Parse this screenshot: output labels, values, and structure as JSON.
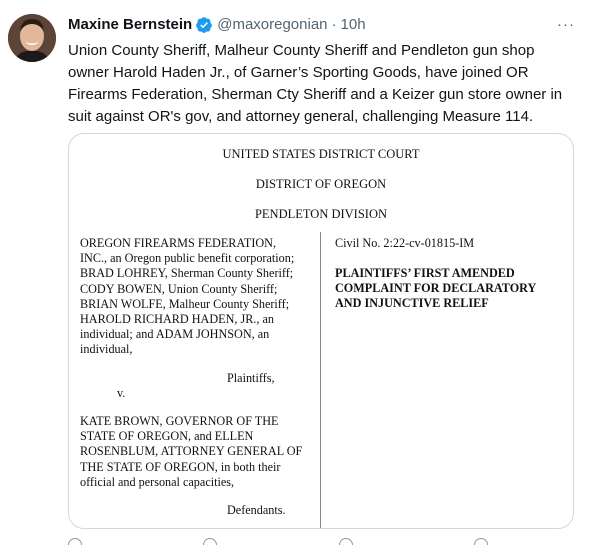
{
  "tweet": {
    "author": {
      "display_name": "Maxine Bernstein",
      "handle": "@maxoregonian",
      "verified_icon": "verified-badge-icon",
      "avatar": "author-photo"
    },
    "separator": "·",
    "timestamp": "10h",
    "more_icon": "more-options-icon",
    "more_label": "···",
    "text_lines": [
      "Union County Sheriff, Malheur County Sheriff and Pendleton gun shop",
      "owner Harold Haden Jr., of Garner’s Sporting Goods, have joined OR",
      "Firearms Federation, Sherman Cty Sheriff and a Keizer gun store owner in",
      "suit against OR's gov, and attorney general, challenging Measure 114."
    ]
  },
  "document": {
    "court": "UNITED STATES DISTRICT COURT",
    "district": "DISTRICT OF OREGON",
    "division": "PENDLETON DIVISION",
    "plaintiffs_lines": [
      "OREGON FIREARMS FEDERATION,",
      "INC., an Oregon public benefit corporation;",
      "BRAD LOHREY, Sherman County Sheriff;",
      "CODY BOWEN, Union County Sheriff;",
      "BRIAN WOLFE, Malheur County Sheriff;",
      "HAROLD RICHARD HADEN, JR., an",
      "individual; and ADAM JOHNSON, an",
      "individual,"
    ],
    "plaintiffs_label": "Plaintiffs,",
    "versus": "v.",
    "defendants_lines": [
      "KATE BROWN, GOVERNOR OF THE",
      "STATE OF OREGON, and ELLEN",
      "ROSENBLUM, ATTORNEY GENERAL OF",
      "THE STATE OF OREGON, in both their",
      "official and personal capacities,"
    ],
    "defendants_label": "Defendants.",
    "civil_no": "Civil No. 2:22-cv-01815-IM",
    "complaint_title_lines": [
      "PLAINTIFFS’ FIRST AMENDED",
      "COMPLAINT FOR DECLARATORY",
      "AND INJUNCTIVE RELIEF"
    ]
  },
  "actions": [
    "reply-icon",
    "retweet-icon",
    "like-icon",
    "share-icon"
  ]
}
